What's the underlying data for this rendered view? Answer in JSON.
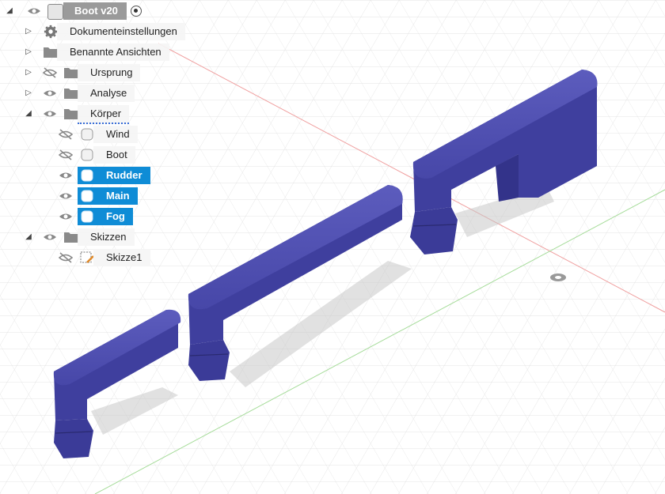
{
  "browser": {
    "root": {
      "label": "Boot v20"
    },
    "items": [
      {
        "label": "Dokumenteinstellungen",
        "icon": "gear-icon"
      },
      {
        "label": "Benannte Ansichten",
        "icon": "folder-icon"
      },
      {
        "label": "Ursprung",
        "icon": "folder-icon",
        "visible": false
      },
      {
        "label": "Analyse",
        "icon": "folder-icon",
        "visible": true
      },
      {
        "label": "Körper",
        "icon": "folder-icon",
        "visible": true,
        "expanded": true,
        "children": [
          {
            "label": "Wind",
            "visible": false,
            "selected": false
          },
          {
            "label": "Boot",
            "visible": false,
            "selected": false
          },
          {
            "label": "Rudder",
            "visible": true,
            "selected": true
          },
          {
            "label": "Main",
            "visible": true,
            "selected": true
          },
          {
            "label": "Fog",
            "visible": true,
            "selected": true
          }
        ]
      },
      {
        "label": "Skizzen",
        "icon": "folder-icon",
        "visible": true,
        "expanded": true,
        "children": [
          {
            "label": "Skizze1",
            "visible": false,
            "icon": "sketch-icon"
          }
        ]
      }
    ]
  },
  "colors": {
    "body": "#4a4aa8",
    "selection": "#0f8cd6",
    "axis_red": "#e88",
    "axis_green": "#8c8"
  }
}
